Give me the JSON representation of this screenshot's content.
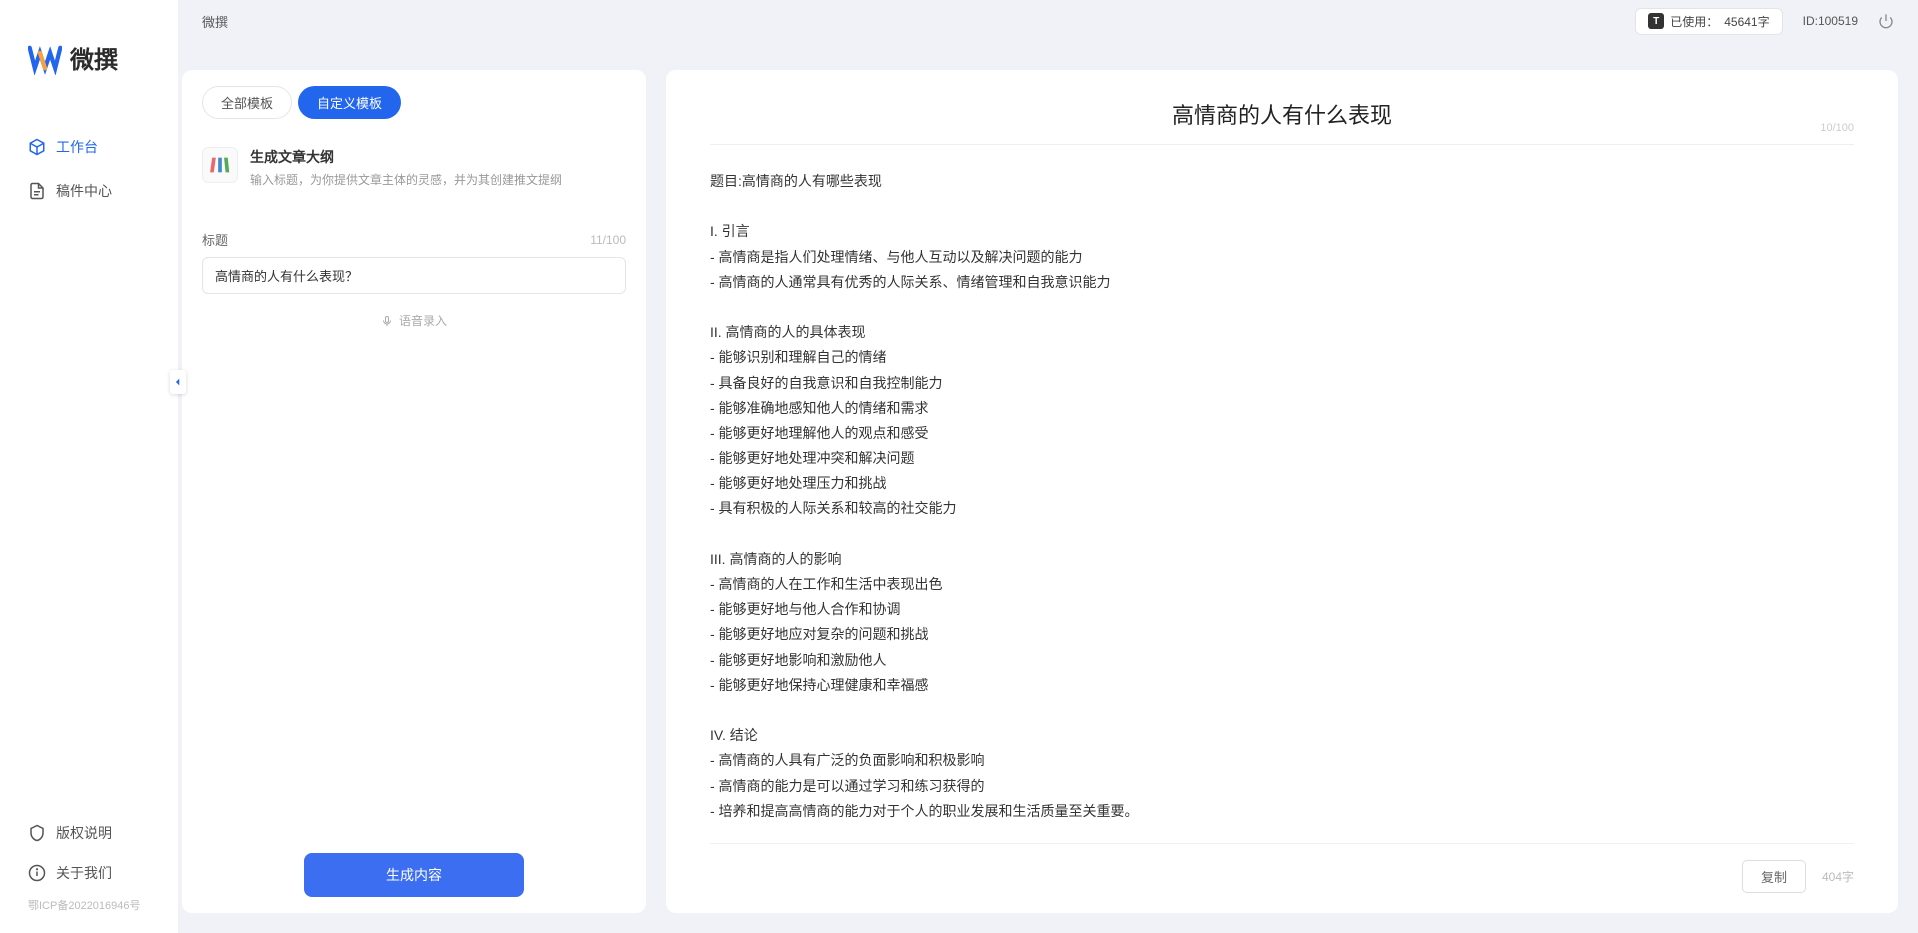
{
  "brand": "微撰",
  "sidebar": {
    "items": [
      {
        "label": "工作台",
        "active": true
      },
      {
        "label": "稿件中心",
        "active": false
      }
    ],
    "footer": [
      {
        "label": "版权说明"
      },
      {
        "label": "关于我们"
      }
    ],
    "icp": "鄂ICP备2022016946号"
  },
  "topbar": {
    "title": "微撰",
    "usage_label": "已使用：",
    "usage_value": "45641字",
    "user_id": "ID:100519"
  },
  "left_panel": {
    "tabs": [
      {
        "label": "全部模板",
        "active": false
      },
      {
        "label": "自定义模板",
        "active": true
      }
    ],
    "template": {
      "title": "生成文章大纲",
      "desc": "输入标题，为你提供文章主体的灵感，并为其创建推文提纲"
    },
    "field_label": "标题",
    "field_count": "11/100",
    "input_value": "高情商的人有什么表现？",
    "voice_label": "语音录入",
    "generate_label": "生成内容"
  },
  "right_panel": {
    "title": "高情商的人有什么表现",
    "title_count": "10/100",
    "body": "题目:高情商的人有哪些表现\n\nI. 引言\n- 高情商是指人们处理情绪、与他人互动以及解决问题的能力\n- 高情商的人通常具有优秀的人际关系、情绪管理和自我意识能力\n\nII. 高情商的人的具体表现\n- 能够识别和理解自己的情绪\n- 具备良好的自我意识和自我控制能力\n- 能够准确地感知他人的情绪和需求\n- 能够更好地理解他人的观点和感受\n- 能够更好地处理冲突和解决问题\n- 能够更好地处理压力和挑战\n- 具有积极的人际关系和较高的社交能力\n\nIII. 高情商的人的影响\n- 高情商的人在工作和生活中表现出色\n- 能够更好地与他人合作和协调\n- 能够更好地应对复杂的问题和挑战\n- 能够更好地影响和激励他人\n- 能够更好地保持心理健康和幸福感\n\nIV. 结论\n- 高情商的人具有广泛的负面影响和积极影响\n- 高情商的能力是可以通过学习和练习获得的\n- 培养和提高高情商的能力对于个人的职业发展和生活质量至关重要。",
    "copy_label": "复制",
    "char_count": "404字"
  }
}
